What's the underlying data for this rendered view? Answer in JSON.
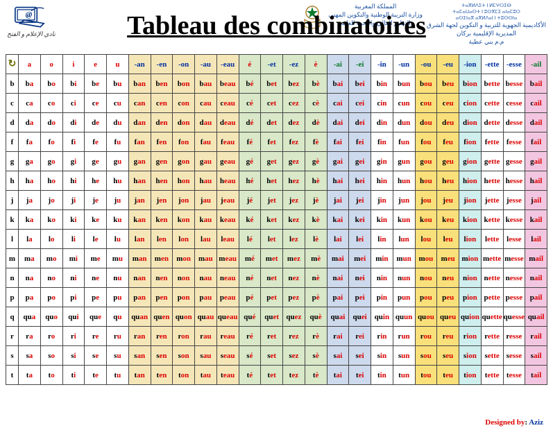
{
  "title": "Tableau des combinatoires",
  "leftCaption": "نادي الإعلام و الفتح",
  "header_right": {
    "line1": "المملكة المغربية",
    "line2": "وزارة التربية الوطنية والتكوين المهني",
    "line3": "والتعليم العالي والبحث العلمي",
    "tiny1": "ⵜⴰⴳⵍⴷⵉⵜ ⵏ ⵍⵎⵖⵔⵉⴱ",
    "tiny2": "ⵜⴰⵎⴰⵡⴰⵙⵜ ⵏ ⵓⵙⴳⵎⵉ ⴰⵏⴰⵎⵓⵔ",
    "tiny3": "ⴰⵙⵉⵏⴰⴳ ⴰⴳⵍⴷⴰⵏ ⵏ ⵜⵓⵙⵙⵏⴰ",
    "line4": "الأكاديمية الجهوية للتربية و التكوين لجهة الشرق",
    "line5": "المديرية الإقليمية بركان",
    "line6": "م.م بني عطية"
  },
  "columns": [
    {
      "key": "a",
      "label": "a",
      "hclass": "hdr-cell",
      "grp": "grp-vowel"
    },
    {
      "key": "o",
      "label": "o",
      "hclass": "hdr-cell",
      "grp": "grp-vowel"
    },
    {
      "key": "i",
      "label": "i",
      "hclass": "hdr-cell",
      "grp": "grp-vowel"
    },
    {
      "key": "e",
      "label": "e",
      "hclass": "hdr-cell",
      "grp": "grp-vowel"
    },
    {
      "key": "u",
      "label": "u",
      "hclass": "hdr-cell",
      "grp": "grp-vowel"
    },
    {
      "key": "an",
      "label": "-an",
      "hclass": "hdr-blue",
      "grp": "grp-an"
    },
    {
      "key": "en",
      "label": "-en",
      "hclass": "hdr-blue",
      "grp": "grp-an"
    },
    {
      "key": "on",
      "label": "-on",
      "hclass": "hdr-blue",
      "grp": "grp-an"
    },
    {
      "key": "au",
      "label": "-au",
      "hclass": "hdr-blue",
      "grp": "grp-an"
    },
    {
      "key": "eau",
      "label": "-eau",
      "hclass": "hdr-blue",
      "grp": "grp-an"
    },
    {
      "key": "é",
      "label": "é",
      "hclass": "hdr-cell",
      "grp": "grp-e"
    },
    {
      "key": "et",
      "label": "-et",
      "hclass": "hdr-blue",
      "grp": "grp-e"
    },
    {
      "key": "ez",
      "label": "-ez",
      "hclass": "hdr-blue",
      "grp": "grp-e"
    },
    {
      "key": "è",
      "label": "è",
      "hclass": "hdr-cell",
      "grp": "grp-e"
    },
    {
      "key": "ai",
      "label": "-ai",
      "hclass": "hdr-green",
      "grp": "grp-ai"
    },
    {
      "key": "ei",
      "label": "-ei",
      "hclass": "hdr-green",
      "grp": "grp-ai"
    },
    {
      "key": "in",
      "label": "-in",
      "hclass": "hdr-blue",
      "grp": "grp-in"
    },
    {
      "key": "un",
      "label": "-un",
      "hclass": "hdr-blue",
      "grp": "grp-in"
    },
    {
      "key": "ou",
      "label": "-ou",
      "hclass": "hdr-blue",
      "grp": "grp-ou"
    },
    {
      "key": "eu",
      "label": "-eu",
      "hclass": "hdr-blue",
      "grp": "grp-ou"
    },
    {
      "key": "ion",
      "label": "-ion",
      "hclass": "hdr-blue",
      "grp": "grp-ion"
    },
    {
      "key": "ette",
      "label": "-ette",
      "hclass": "hdr-blue",
      "grp": "grp-ette"
    },
    {
      "key": "esse",
      "label": "-esse",
      "hclass": "hdr-blue",
      "grp": "grp-ette"
    },
    {
      "key": "ail",
      "label": "-ail",
      "hclass": "hdr-green",
      "grp": "grp-ail"
    }
  ],
  "rows": [
    "b",
    "c",
    "d",
    "f",
    "g",
    "h",
    "j",
    "k",
    "l",
    "m",
    "n",
    "p",
    "q",
    "r",
    "s",
    "t"
  ],
  "qu_vowels": {
    "a": "qua",
    "o": "quo",
    "i": "qui",
    "e": "que",
    "u": "qu"
  },
  "footer": {
    "by": "Designed by",
    "sep": ": ",
    "name": "Aziz"
  }
}
